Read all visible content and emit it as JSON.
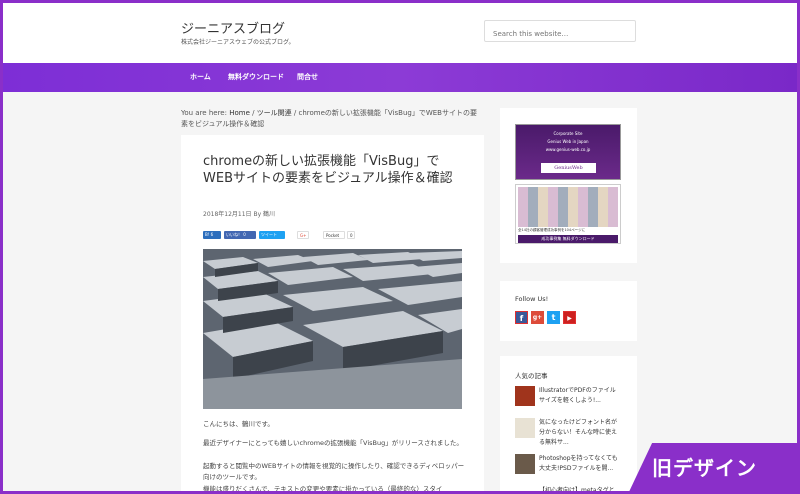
{
  "header": {
    "site_title": "ジーニアスブログ",
    "site_description": "株式会社ジーニアスウェブの公式ブログ。",
    "search_placeholder": "Search this website…"
  },
  "nav": {
    "items": [
      "ホーム",
      "無料ダウンロード",
      "問合せ"
    ]
  },
  "breadcrumb": {
    "prefix": "You are here: ",
    "home": "Home",
    "sep1": " / ",
    "category": "ツール関連",
    "sep2": " / ",
    "current": "chromeの新しい拡張機能「VisBug」でWEBサイトの要素をビジュアル操作＆確認"
  },
  "post": {
    "title": "chromeの新しい拡張機能「VisBug」でWEBサイトの要素をビジュアル操作＆確認",
    "meta": "2018年12月11日 By 鶴川",
    "share": {
      "hatena": "B! 6",
      "like": "いいね！ 0",
      "tweet": "ツイート",
      "gplus": "G+",
      "pocket": "Pocket",
      "pocket_count": "0"
    },
    "paragraphs": [
      "こんにちは、鶴川です。",
      "最近デザイナーにとっても嬉しいchromeの拡張機能「VisBug」がリリースされました。",
      "起動すると閲覧中のWEBサイトの情報を視覚的に操作したり、確認できるディベロッパー向けのツールです。",
      "機能は盛りだくさんで、テキストの変更や要素に掛かっている（最終的な）スタイ"
    ]
  },
  "sidebar": {
    "banner1": {
      "line1": "Corporate Site",
      "line2": "Genius Web in Japan",
      "line3": "www.genius-web.co.jp",
      "logo": "GeniusWeb"
    },
    "banner2": {
      "caption": "全14社の顧客管理成功事例を104ページに",
      "button": "成功事例集 無料ダウンロード"
    },
    "follow_title": "Follow Us!",
    "social": [
      {
        "name": "facebook",
        "glyph": "f",
        "color": "#3b5998"
      },
      {
        "name": "google-plus",
        "glyph": "g+",
        "color": "#dd4b39"
      },
      {
        "name": "twitter",
        "glyph": "t",
        "color": "#1da1f2"
      },
      {
        "name": "youtube",
        "glyph": "▶",
        "color": "#cd201f"
      }
    ],
    "popular_title": "人気の記事",
    "popular": [
      "IllustratorでPDFのファイルサイズを軽くしよう!...",
      "気になったけどフォント名が分からない！そんな時に使える無料サ...",
      "Photoshopを持ってなくても大丈夫!PSDファイルを開..."
    ],
    "popular_partial": "【初心者向け】metaタグと"
  },
  "badge": {
    "text": "旧デザイン"
  }
}
